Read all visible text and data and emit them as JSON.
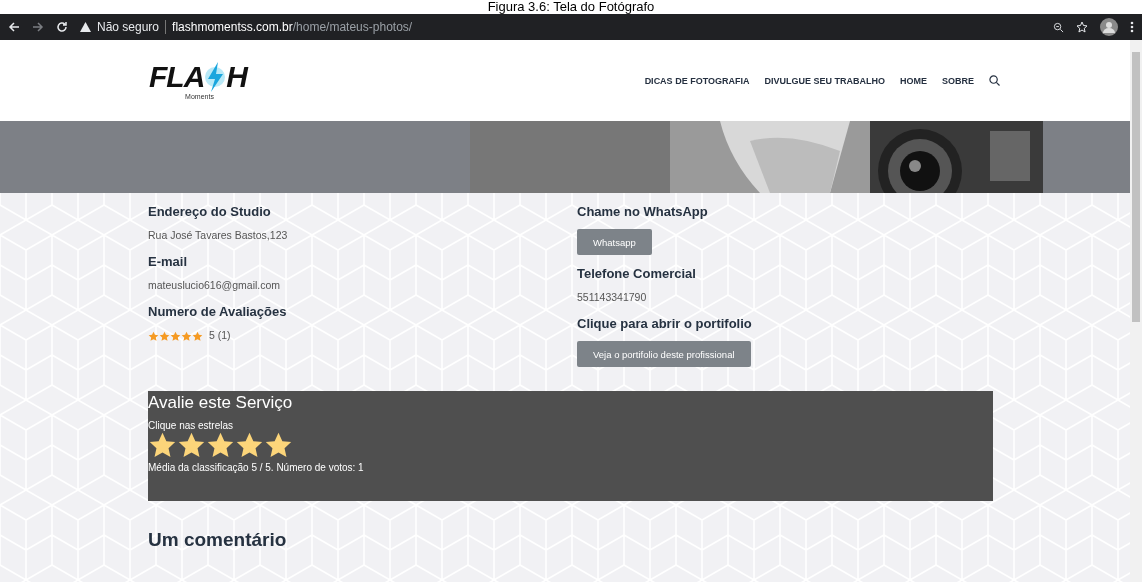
{
  "caption": "Figura 3.6: Tela do Fotógrafo",
  "browser": {
    "security": "Não seguro",
    "domain": "flashmomentss.com.br",
    "path": "/home/mateus-photos/"
  },
  "site": {
    "logo": "FLA",
    "logo_end": "H",
    "logo_sub": "Moments",
    "nav": [
      "DICAS DE FOTOGRAFIA",
      "DIVULGUE SEU TRABALHO",
      "HOME",
      "SOBRE"
    ]
  },
  "left": [
    {
      "heading": "Endereço do Studio",
      "kind": "text",
      "value": "Rua José Tavares Bastos,123"
    },
    {
      "heading": "E-mail",
      "kind": "text",
      "value": "mateuslucio616@gmail.com"
    },
    {
      "heading": "Numero de Avaliações",
      "kind": "rating",
      "stars": 5,
      "value": "5 (1)"
    }
  ],
  "right": [
    {
      "heading": "Chame no WhatsApp",
      "kind": "button",
      "value": "Whatsapp"
    },
    {
      "heading": "Telefone Comercial",
      "kind": "text",
      "value": "551143341790"
    },
    {
      "heading": "Clique para abrir o portifolio",
      "kind": "button",
      "value": "Veja o portifolio deste profissional"
    }
  ],
  "vote": {
    "title": "Avalie este Serviço",
    "hint": "Clique nas estrelas",
    "stars": 5,
    "summary": "Média da classificação 5 / 5. Número de votos: 1"
  },
  "comments_title": "Um comentário"
}
